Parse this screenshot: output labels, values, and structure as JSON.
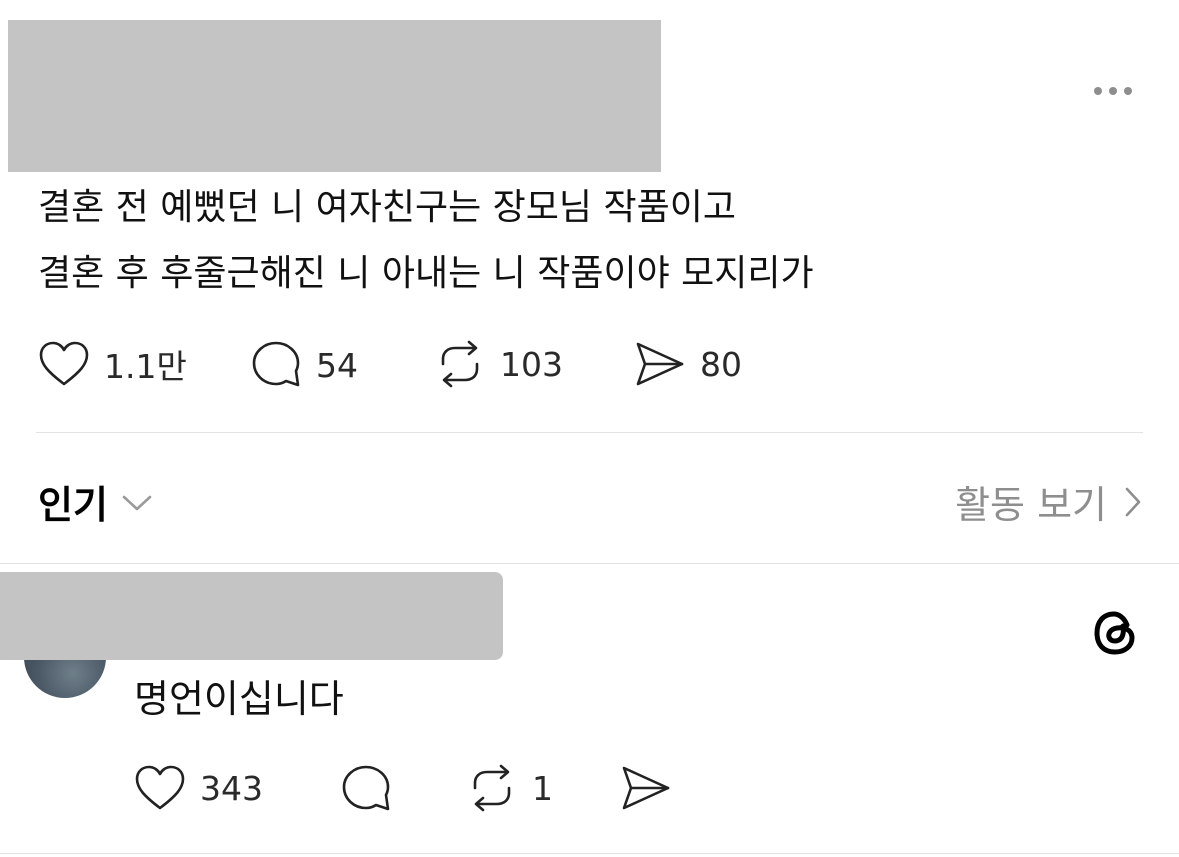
{
  "post": {
    "lines": [
      "결혼 전 예뻤던 니 여자친구는 장모님 작품이고",
      "결혼 후 후줄근해진 니 아내는 니 작품이야 모지리가"
    ],
    "actions": {
      "likes": "1.1만",
      "replies": "54",
      "reposts": "103",
      "shares": "80"
    }
  },
  "sort": {
    "label": "인기",
    "activity_link": "활동 보기"
  },
  "reply": {
    "text": "명언이십니다",
    "actions": {
      "likes": "343",
      "reposts": "1"
    }
  },
  "icons": {
    "more": "more-horizontal-icon",
    "like": "heart-icon",
    "reply": "comment-icon",
    "repost": "repost-icon",
    "share": "send-icon",
    "dropdown": "chevron-down-icon",
    "activity": "chevron-right-icon",
    "threads": "threads-logo-icon"
  },
  "colors": {
    "redaction": "#c4c4c4",
    "muted_text": "#8e8e8e",
    "divider": "#e3e3e3"
  }
}
